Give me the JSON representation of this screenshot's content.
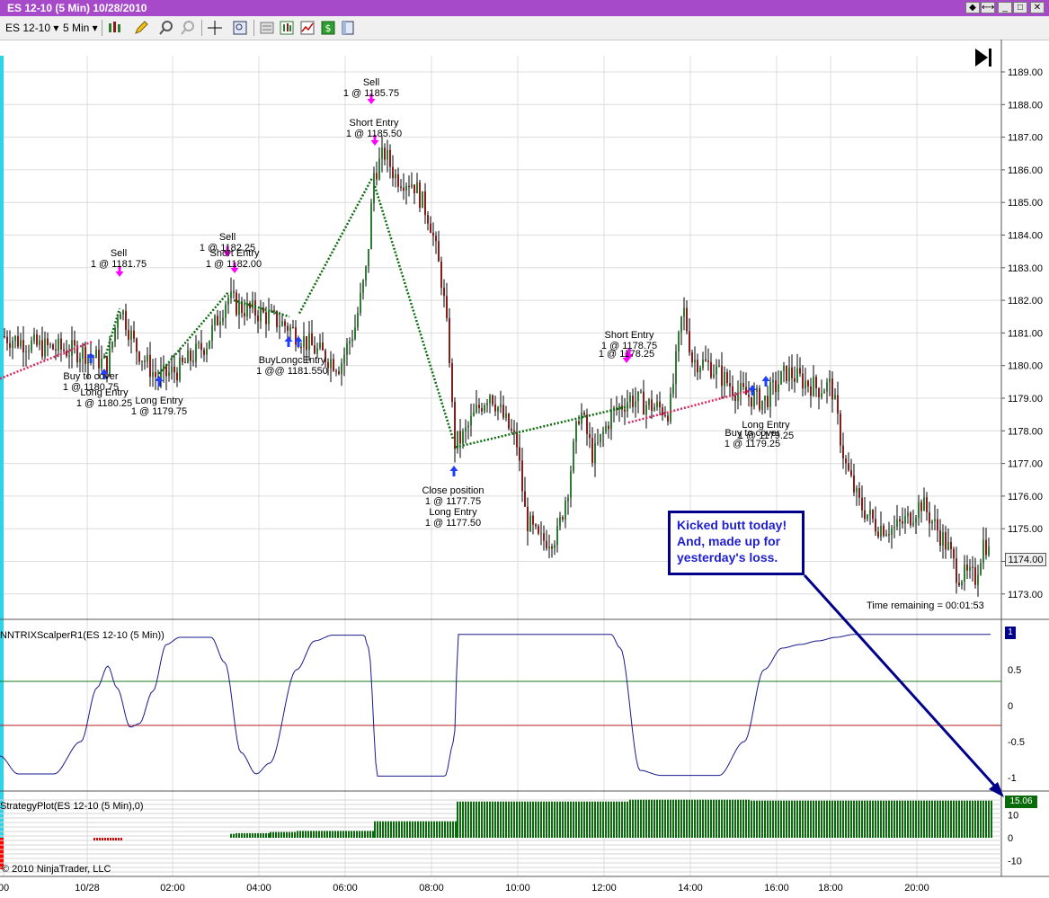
{
  "window": {
    "title": "ES 12-10 (5 Min)  10/28/2010",
    "buttons": [
      "◆",
      "⟷",
      "_",
      "□",
      "✕"
    ]
  },
  "toolbar": {
    "instrument": "ES 12-10",
    "interval": "5 Min",
    "icons": [
      "bar-style-icon",
      "pencil-icon",
      "zoom-in-icon",
      "zoom-out-icon",
      "crosshair-icon",
      "data-box-icon",
      "properties-icon",
      "indicators-icon",
      "strategies-icon",
      "money-icon",
      "chart-trader-icon"
    ]
  },
  "price_axis": {
    "labels": [
      "1189.00",
      "1188.00",
      "1187.00",
      "1186.00",
      "1185.00",
      "1184.00",
      "1183.00",
      "1182.00",
      "1181.00",
      "1180.00",
      "1179.00",
      "1178.00",
      "1177.00",
      "1176.00",
      "1175.00",
      "1174.00",
      "1173.00"
    ],
    "current_price": "1174.00"
  },
  "time_axis": {
    "labels": [
      "00",
      "10/28",
      "02:00",
      "04:00",
      "06:00",
      "08:00",
      "10:00",
      "12:00",
      "14:00",
      "16:00",
      "18:00",
      "20:00"
    ]
  },
  "annotations": {
    "sell1_title": "Sell",
    "sell1_price": "1 @ 1181.75",
    "sell2_title": "Sell",
    "sell2_price": "1 @ 1182.25",
    "short1_title": "Short Entry",
    "short1_price": "1 @ 1182.00",
    "sell3_title": "Sell",
    "sell3_price": "1 @ 1185.75",
    "short2_title": "Short Entry",
    "short2_price": "1 @ 1185.50",
    "btc1_title": "Buy to cover",
    "btc1_price": "1 @ 1180.75",
    "long1_title": "Long Entry",
    "long1_price": "1 @ 1180.25",
    "long2_title": "Long Entry",
    "long2_price": "1 @ 1179.75",
    "buy_long_title": "BuyLongcEntry",
    "buy_long_price": "1 @@ 1181.550",
    "close_title": "Close position",
    "close_price": "1 @ 1177.75",
    "long3_title": "Long Entry",
    "long3_price": "1 @ 1177.50",
    "short3_title": "Short Entry",
    "short3_price": "1 @ 1178.75",
    "short3_price2": "1 @ 1178.25",
    "long4_title": "Long Entry",
    "long4_price": "1 @ 1179.25",
    "btc2_title": "Buy to cover",
    "btc2_price": "1 @ 1179.25"
  },
  "callout": {
    "line1": "Kicked butt today!",
    "line2": "And, made up for",
    "line3": "yesterday's loss."
  },
  "time_remaining": "Time remaining = 00:01:53",
  "oscillator": {
    "label": "NNTRIXScalperR1(ES 12-10 (5 Min))",
    "axis_labels": [
      "1",
      "0.5",
      "0",
      "-0.5",
      "-1"
    ],
    "current_value": "1"
  },
  "strategy_plot": {
    "label": "StrategyPlot(ES 12-10 (5 Min),0)",
    "axis_labels": [
      "10",
      "0",
      "-10"
    ],
    "current_value": "15.06"
  },
  "copyright": "© 2010 NinjaTrader, LLC",
  "colors": {
    "title_bar": "#a64ac9",
    "up_candle": "#2e7d32",
    "down_candle": "#8b1a1a",
    "sell_arrow": "#ff00ff",
    "buy_arrow": "#1f3fff",
    "callout": "#1f1fd1",
    "oscillator_line": "#1a1a8c",
    "strategy_bars": "#0a6b0a"
  }
}
